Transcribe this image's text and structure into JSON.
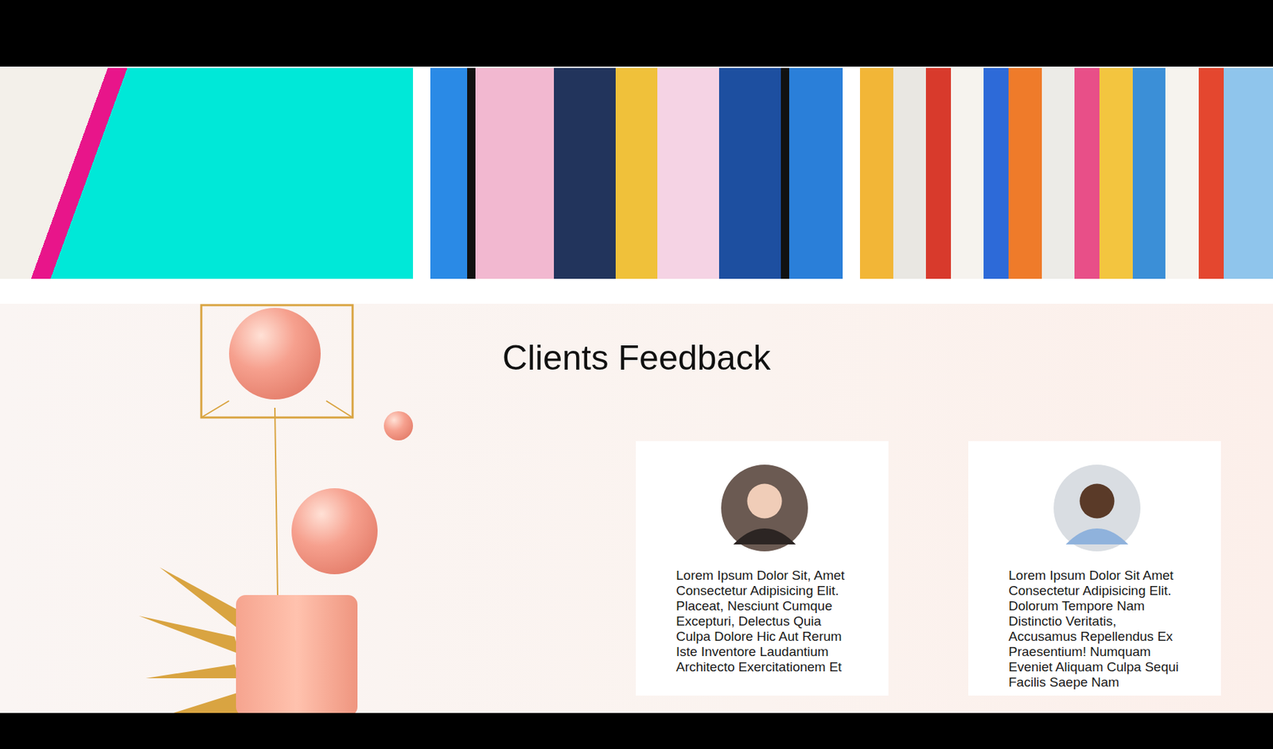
{
  "feedback": {
    "title": "Clients Feedback"
  },
  "testimonials": [
    {
      "text": "Lorem Ipsum Dolor Sit, Amet Consectetur Adipisicing Elit. Placeat, Nesciunt Cumque Excepturi, Delectus Quia Culpa Dolore Hic Aut Rerum Iste Inventore Laudantium Architecto Exercitationem Et"
    },
    {
      "text": "Lorem Ipsum Dolor Sit Amet Consectetur Adipisicing Elit. Dolorum Tempore Nam Distinctio Veritatis, Accusamus Repellendus Ex Praesentium! Numquam Eveniet Aliquam Culpa Sequi Facilis Saepe Nam"
    }
  ]
}
